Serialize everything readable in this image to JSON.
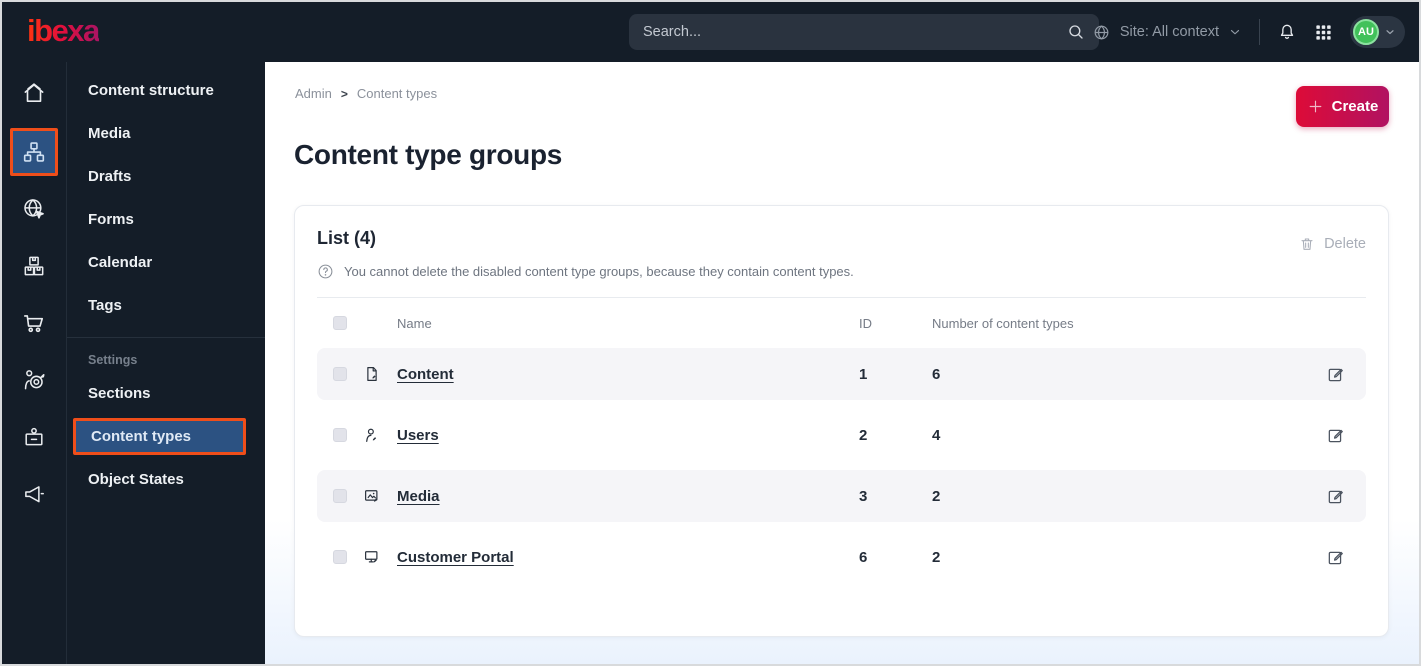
{
  "topbar": {
    "logo_text": "ibexa",
    "search": {
      "placeholder": "Search..."
    },
    "site_context_label": "Site: All context",
    "avatar_initials": "AU"
  },
  "icon_rail": {
    "items": [
      {
        "icon": "home-icon",
        "active": false
      },
      {
        "icon": "sitemap-icon",
        "active": true
      },
      {
        "icon": "globe-pointer-icon",
        "active": false
      },
      {
        "icon": "boxes-icon",
        "active": false
      },
      {
        "icon": "cart-icon",
        "active": false
      },
      {
        "icon": "person-target-icon",
        "active": false
      },
      {
        "icon": "badge-icon",
        "active": false
      },
      {
        "icon": "megaphone-icon",
        "active": false
      }
    ]
  },
  "sidebar": {
    "items": [
      "Content structure",
      "Media",
      "Drafts",
      "Forms",
      "Calendar",
      "Tags"
    ],
    "section_label": "Settings",
    "settings_items": [
      {
        "label": "Sections",
        "active": false
      },
      {
        "label": "Content types",
        "active": true
      },
      {
        "label": "Object States",
        "active": false
      }
    ]
  },
  "main": {
    "breadcrumb": [
      "Admin",
      "Content types"
    ],
    "breadcrumb_separator": ">",
    "create_button_label": "Create",
    "page_title": "Content type groups",
    "card": {
      "list_title": "List (4)",
      "help_text": "You cannot delete the disabled content type groups, because they contain content types.",
      "delete_button_label": "Delete",
      "table": {
        "columns": [
          "Name",
          "ID",
          "Number of content types"
        ],
        "rows": [
          {
            "icon": "file-icon",
            "name": "Content",
            "id": "1",
            "count": "6"
          },
          {
            "icon": "user-icon",
            "name": "Users",
            "id": "2",
            "count": "4"
          },
          {
            "icon": "image-icon",
            "name": "Media",
            "id": "3",
            "count": "2"
          },
          {
            "icon": "monitor-icon",
            "name": "Customer Portal",
            "id": "6",
            "count": "2"
          }
        ]
      }
    }
  },
  "colors": {
    "topbar_bg": "#141d28",
    "active_highlight_bg": "#2c5282",
    "annotation_orange": "#ef4e1a",
    "create_gradient_start": "#dd0b38",
    "create_gradient_end": "#b11261",
    "avatar_green": "#41c15a",
    "row_alt_bg": "#f5f5f8"
  }
}
